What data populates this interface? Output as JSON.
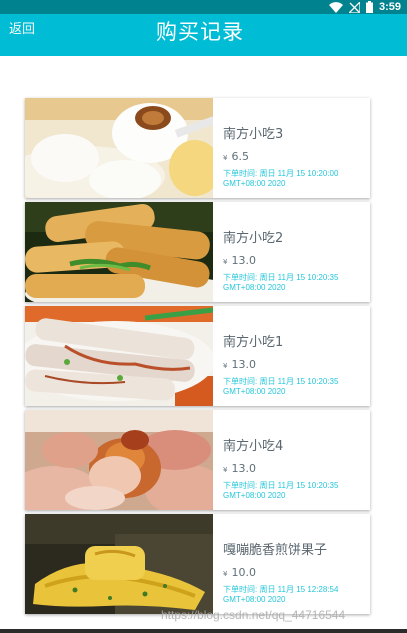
{
  "status_bar": {
    "time": "3:59",
    "icons": [
      "wifi-icon",
      "no-signal-icon",
      "battery-icon"
    ],
    "color": "#00838f"
  },
  "app_bar": {
    "back_label": "返回",
    "title": "购买记录",
    "color": "#00bcd4"
  },
  "orders": [
    {
      "name": "南方小吃3",
      "currency": "¥",
      "price": "6.5",
      "time_line1": "下单时间: 周日 11月 15 10:20:00",
      "time_line2": "GMT+08:00 2020",
      "image": "tangyuan-dumplings"
    },
    {
      "name": "南方小吃2",
      "currency": "¥",
      "price": "13.0",
      "time_line1": "下单时间: 周日 11月 15 10:20:35",
      "time_line2": "GMT+08:00 2020",
      "image": "spring-rolls"
    },
    {
      "name": "南方小吃1",
      "currency": "¥",
      "price": "13.0",
      "time_line1": "下单时间: 周日 11月 15 10:20:35",
      "time_line2": "GMT+08:00 2020",
      "image": "rice-noodle-rolls"
    },
    {
      "name": "南方小吃4",
      "currency": "¥",
      "price": "13.0",
      "time_line1": "下单时间: 周日 11月 15 10:20:35",
      "time_line2": "GMT+08:00 2020",
      "image": "crispy-pastries"
    },
    {
      "name": "嘎嘣脆香煎饼果子",
      "currency": "¥",
      "price": "10.0",
      "time_line1": "下单时间: 周日 11月 15 12:28:54",
      "time_line2": "GMT+08:00 2020",
      "image": "jianbing-pancake"
    }
  ],
  "watermark": "https://blog.csdn.net/qq_44716544",
  "accent_text_color": "#26c6da"
}
